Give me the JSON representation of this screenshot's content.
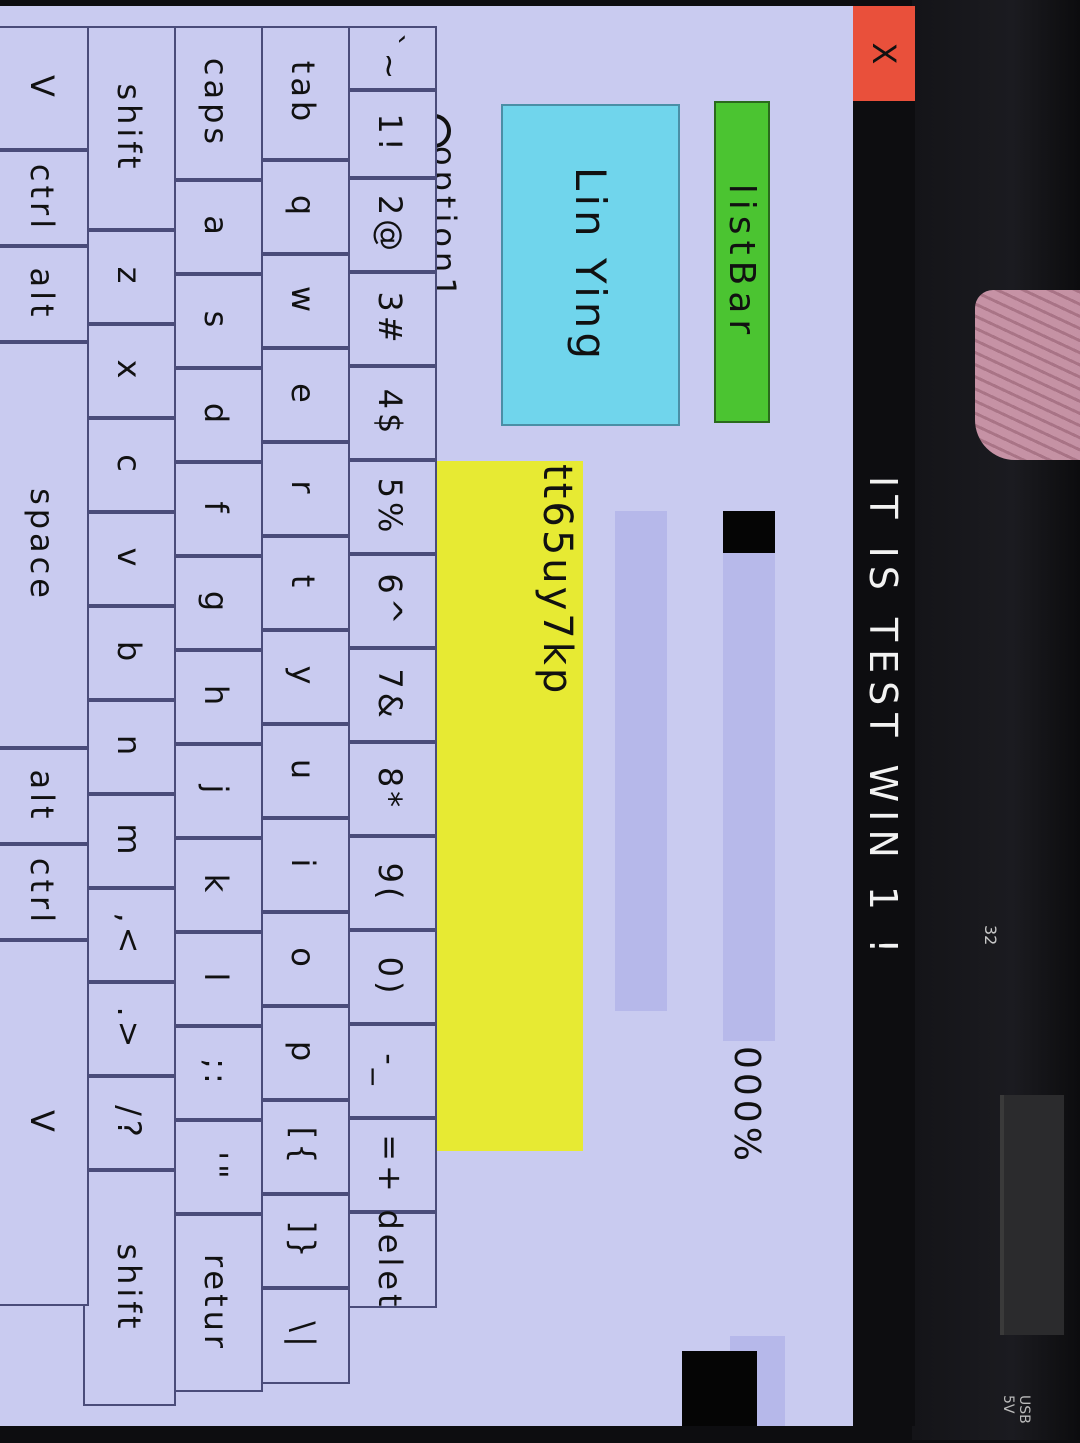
{
  "window": {
    "title": "IT IS TEST WIN 1 !",
    "close_label": "X"
  },
  "widgets": {
    "listbar_label": "listBar",
    "progress_text": "000%",
    "progress_value": 0.08,
    "name_label": "Lin Ying",
    "text_value": "tt65uy7kp",
    "radio_label": "option1"
  },
  "keyboard": {
    "rows": [
      [
        "`~",
        "1!",
        "2@",
        "3#",
        "4$",
        "5%",
        "6^",
        "7&",
        "8*",
        "9(",
        "0)",
        "-_",
        "=+",
        "delet"
      ],
      [
        "tab",
        "q",
        "w",
        "e",
        "r",
        "t",
        "y",
        "u",
        "i",
        "o",
        "p",
        "[{",
        "]}",
        "\\|"
      ],
      [
        "caps",
        "a",
        "s",
        "d",
        "f",
        "g",
        "h",
        "j",
        "k",
        "l",
        ";:",
        "'\"",
        "retur"
      ],
      [
        "shift",
        "z",
        "x",
        "c",
        "v",
        "b",
        "n",
        "m",
        ",<",
        ".>",
        "/?",
        "shift"
      ],
      [
        "V",
        "ctrl",
        "alt",
        "space",
        "alt",
        "ctrl",
        "V"
      ]
    ]
  },
  "board": {
    "pcb_label": "32",
    "usb_label": "USB\n5V"
  },
  "colors": {
    "screen_bg": "#c9cbf0",
    "close_bg": "#e9503b",
    "listbar_bg": "#4bc431",
    "name_bg": "#70d5ec",
    "text_bg": "#e7ea33"
  }
}
